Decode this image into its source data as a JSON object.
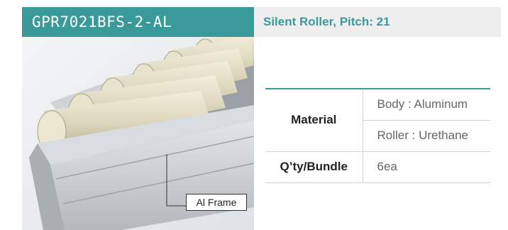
{
  "header": {
    "model": "GPR7021BFS-2-AL",
    "subtitle": "Silent Roller, Pitch: 21"
  },
  "photo": {
    "frame_label": "Al Frame"
  },
  "specs": {
    "material_label": "Material",
    "body_value": "Body : Aluminum",
    "roller_value": "Roller : Urethane",
    "qty_label": "Q’ty/Bundle",
    "qty_value": "6ea"
  },
  "colors": {
    "accent": "#3a9a9a",
    "roller": "#e0dbc4",
    "frame": "#c9ccd0"
  }
}
